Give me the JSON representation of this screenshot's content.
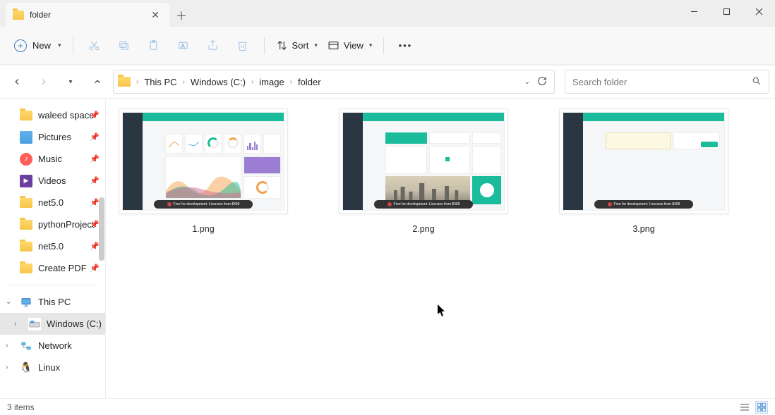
{
  "window": {
    "tab_title": "folder",
    "new_label": "New",
    "sort_label": "Sort",
    "view_label": "View"
  },
  "breadcrumbs": {
    "seg0": "This PC",
    "seg1": "Windows (C:)",
    "seg2": "image",
    "seg3": "folder"
  },
  "search": {
    "placeholder": "Search folder"
  },
  "sidebar": {
    "waleed": "waleed space",
    "pictures": "Pictures",
    "music": "Music",
    "videos": "Videos",
    "net50a": "net5.0",
    "python": "pythonProject",
    "net50b": "net5.0",
    "createpdf": "Create PDF",
    "thispc": "This PC",
    "windows": "Windows (C:)",
    "network": "Network",
    "linux": "Linux"
  },
  "files": {
    "f1": "1.png",
    "f2": "2.png",
    "f3": "3.png"
  },
  "thumb_footer": "Free for development. Licenses from $499",
  "status": {
    "count": "3 items"
  }
}
